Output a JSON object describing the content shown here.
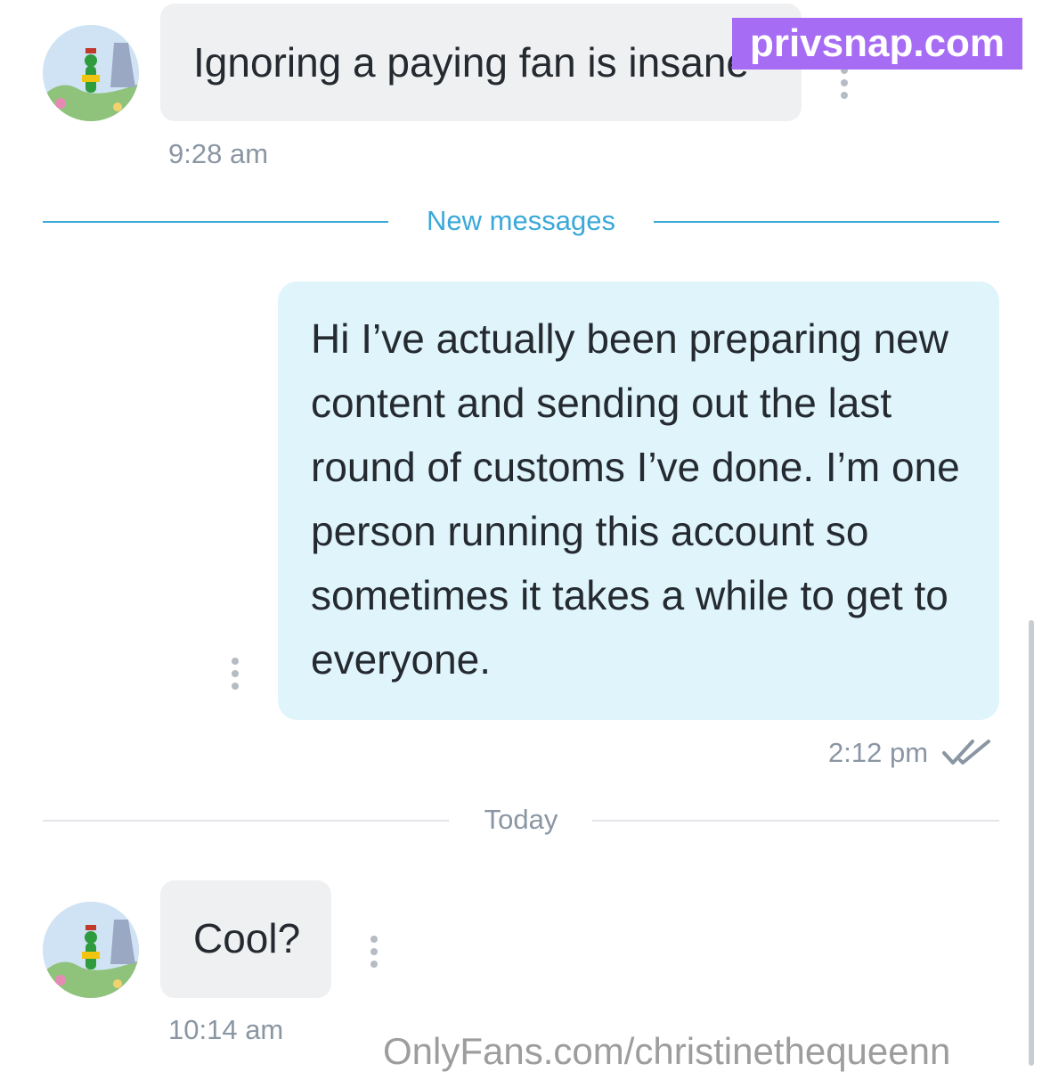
{
  "messages": [
    {
      "text": "Ignoring a paying fan is insane",
      "time": "9:28 am"
    },
    {
      "text": "Hi I’ve actually been preparing new content and sending out the last round of customs I’ve done. I’m one person running this account so sometimes it takes a while to get to everyone.",
      "time": "2:12 pm"
    },
    {
      "text": "Cool?",
      "time": "10:14 am"
    }
  ],
  "dividers": {
    "new_messages": "New messages",
    "today": "Today"
  },
  "watermarks": {
    "top": "privsnap.com",
    "bottom": "OnlyFans.com/christinethequeenn"
  },
  "colors": {
    "accent": "#3aa8d8",
    "incoming_bubble": "#eff0f2",
    "outgoing_bubble": "#dff4fb",
    "timestamp": "#8a96a3",
    "watermark_badge": "#a66cf4"
  },
  "icons": {
    "avatar": "cartoon-figure-avatar",
    "options": "vertical-dots-icon",
    "read_receipt": "double-check-icon"
  }
}
